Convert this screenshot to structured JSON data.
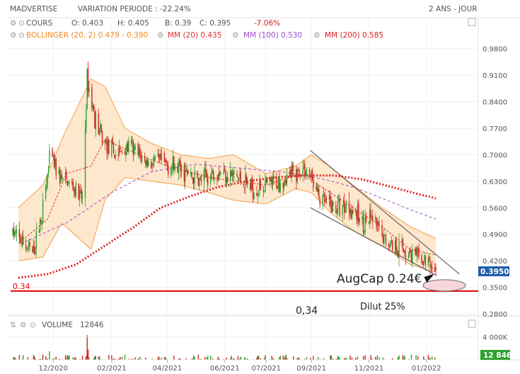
{
  "header": {
    "symbol": "MADVERTISE",
    "variation": "VARIATION PERIODE : -22.24%",
    "period": "2 ANS - JOUR"
  },
  "legend": {
    "cours_label": "COURS",
    "open": "O: 0.403",
    "high": "H: 0.405",
    "low": "B: 0.39",
    "close": "C: 0.395",
    "change": "-7.06%",
    "bollinger": "BOLLINGER (20, 2) 0.479 - 0.390",
    "mm20": "MM (20) 0.435",
    "mm100": "MM (100) 0.530",
    "mm200": "MM (200) 0.585"
  },
  "volume_legend": {
    "label": "VOLUME",
    "value": "12846"
  },
  "annotations": {
    "augcap": "AugCap 0.24€",
    "level_left": "0.34",
    "level_mid": "0,34",
    "dilut": "Dilut 25%"
  },
  "price_badge": "0.3950",
  "volume_badge": "12 846",
  "colors": {
    "up": "#2ea12e",
    "down": "#d62020",
    "bollinger": "#f5a04a",
    "bollinger_fill": "#fde3c4",
    "mm20": "#e03030",
    "mm100": "#9b4fc9",
    "mm200": "#e02020",
    "support": "#e00000",
    "channel": "#555555",
    "badge": "#1f5fa8",
    "volume_badge": "#2ea12e"
  },
  "chart_data": {
    "type": "candlestick",
    "title": "MADVERTISE",
    "y_ticks": [
      "0.9800",
      "0.9100",
      "0.8400",
      "0.7700",
      "0.7000",
      "0.6300",
      "0.5600",
      "0.4900",
      "0.4200",
      "0.3500",
      "0.2800"
    ],
    "ylim": [
      0.28,
      1.0
    ],
    "x_ticks": [
      "12/2020",
      "02/2021",
      "04/2021",
      "06/2021",
      "07/2021",
      "09/2021",
      "11/2021",
      "01/2022"
    ],
    "x_tick_dates": [
      "2020-12-01",
      "2021-02-01",
      "2021-04-01",
      "2021-06-01",
      "2021-07-15",
      "2021-09-01",
      "2021-11-01",
      "2022-01-01"
    ],
    "date_range": [
      "2020-10-19",
      "2022-01-11"
    ],
    "volume_ticks": [
      "4 000K",
      "0"
    ],
    "volume_max": 5200,
    "last": {
      "open": 0.403,
      "high": 0.405,
      "low": 0.39,
      "close": 0.395,
      "change_pct": -7.06
    },
    "close_anchors": [
      [
        "2020-10-19",
        0.495
      ],
      [
        "2020-11-01",
        0.46
      ],
      [
        "2020-11-10",
        0.44
      ],
      [
        "2020-11-20",
        0.56
      ],
      [
        "2020-11-28",
        0.7
      ],
      [
        "2020-12-08",
        0.64
      ],
      [
        "2020-12-20",
        0.62
      ],
      [
        "2021-01-01",
        0.58
      ],
      [
        "2021-01-06",
        0.9
      ],
      [
        "2021-01-14",
        0.8
      ],
      [
        "2021-01-22",
        0.74
      ],
      [
        "2021-02-05",
        0.7
      ],
      [
        "2021-02-20",
        0.72
      ],
      [
        "2021-03-10",
        0.68
      ],
      [
        "2021-03-25",
        0.68
      ],
      [
        "2021-04-15",
        0.66
      ],
      [
        "2021-05-05",
        0.63
      ],
      [
        "2021-05-25",
        0.66
      ],
      [
        "2021-06-15",
        0.64
      ],
      [
        "2021-07-01",
        0.61
      ],
      [
        "2021-07-20",
        0.62
      ],
      [
        "2021-08-10",
        0.645
      ],
      [
        "2021-08-25",
        0.665
      ],
      [
        "2021-09-01",
        0.64
      ],
      [
        "2021-09-10",
        0.58
      ],
      [
        "2021-09-25",
        0.56
      ],
      [
        "2021-10-10",
        0.57
      ],
      [
        "2021-10-25",
        0.52
      ],
      [
        "2021-11-05",
        0.53
      ],
      [
        "2021-11-15",
        0.48
      ],
      [
        "2021-11-30",
        0.46
      ],
      [
        "2021-12-15",
        0.44
      ],
      [
        "2021-12-28",
        0.42
      ],
      [
        "2022-01-05",
        0.41
      ],
      [
        "2022-01-11",
        0.395
      ]
    ],
    "mm20_anchors": [
      [
        "2020-11-01",
        0.48
      ],
      [
        "2020-11-25",
        0.53
      ],
      [
        "2020-12-15",
        0.65
      ],
      [
        "2021-01-10",
        0.67
      ],
      [
        "2021-01-25",
        0.74
      ],
      [
        "2021-02-20",
        0.71
      ],
      [
        "2021-04-01",
        0.67
      ],
      [
        "2021-05-15",
        0.64
      ],
      [
        "2021-07-15",
        0.62
      ],
      [
        "2021-08-20",
        0.65
      ],
      [
        "2021-09-15",
        0.61
      ],
      [
        "2021-10-15",
        0.56
      ],
      [
        "2021-11-15",
        0.51
      ],
      [
        "2021-12-15",
        0.45
      ],
      [
        "2022-01-11",
        0.435
      ]
    ],
    "bollinger_upper": [
      [
        "2020-10-25",
        0.56
      ],
      [
        "2020-11-20",
        0.62
      ],
      [
        "2020-12-10",
        0.74
      ],
      [
        "2021-01-10",
        0.9
      ],
      [
        "2021-01-25",
        0.88
      ],
      [
        "2021-02-15",
        0.77
      ],
      [
        "2021-03-15",
        0.73
      ],
      [
        "2021-04-15",
        0.7
      ],
      [
        "2021-05-15",
        0.69
      ],
      [
        "2021-06-10",
        0.7
      ],
      [
        "2021-07-15",
        0.65
      ],
      [
        "2021-08-15",
        0.67
      ],
      [
        "2021-09-01",
        0.7
      ],
      [
        "2021-09-20",
        0.67
      ],
      [
        "2021-10-15",
        0.62
      ],
      [
        "2021-11-15",
        0.56
      ],
      [
        "2021-12-15",
        0.51
      ],
      [
        "2022-01-11",
        0.479
      ]
    ],
    "bollinger_lower": [
      [
        "2020-10-25",
        0.42
      ],
      [
        "2020-11-20",
        0.43
      ],
      [
        "2020-12-10",
        0.52
      ],
      [
        "2021-01-10",
        0.45
      ],
      [
        "2021-01-25",
        0.58
      ],
      [
        "2021-02-15",
        0.64
      ],
      [
        "2021-03-15",
        0.63
      ],
      [
        "2021-04-15",
        0.62
      ],
      [
        "2021-05-15",
        0.6
      ],
      [
        "2021-06-10",
        0.58
      ],
      [
        "2021-07-15",
        0.57
      ],
      [
        "2021-08-15",
        0.61
      ],
      [
        "2021-09-01",
        0.6
      ],
      [
        "2021-09-20",
        0.55
      ],
      [
        "2021-10-15",
        0.5
      ],
      [
        "2021-11-15",
        0.46
      ],
      [
        "2021-12-15",
        0.41
      ],
      [
        "2022-01-11",
        0.39
      ]
    ],
    "mm100_anchors": [
      [
        "2020-11-01",
        0.47
      ],
      [
        "2020-12-15",
        0.52
      ],
      [
        "2021-02-01",
        0.6
      ],
      [
        "2021-03-15",
        0.655
      ],
      [
        "2021-05-01",
        0.675
      ],
      [
        "2021-06-15",
        0.665
      ],
      [
        "2021-08-01",
        0.655
      ],
      [
        "2021-09-15",
        0.635
      ],
      [
        "2021-10-15",
        0.615
      ],
      [
        "2021-11-15",
        0.585
      ],
      [
        "2021-12-15",
        0.555
      ],
      [
        "2022-01-11",
        0.53
      ]
    ],
    "mm200_anchors": [
      [
        "2020-10-25",
        0.375
      ],
      [
        "2020-11-25",
        0.385
      ],
      [
        "2020-12-25",
        0.41
      ],
      [
        "2021-01-25",
        0.46
      ],
      [
        "2021-02-25",
        0.51
      ],
      [
        "2021-03-25",
        0.56
      ],
      [
        "2021-04-25",
        0.59
      ],
      [
        "2021-05-25",
        0.615
      ],
      [
        "2021-06-25",
        0.63
      ],
      [
        "2021-07-25",
        0.64
      ],
      [
        "2021-08-25",
        0.645
      ],
      [
        "2021-09-25",
        0.645
      ],
      [
        "2021-10-25",
        0.635
      ],
      [
        "2021-11-25",
        0.615
      ],
      [
        "2021-12-25",
        0.595
      ],
      [
        "2022-01-11",
        0.585
      ]
    ],
    "channel_upper": [
      [
        "2021-08-31",
        0.711
      ],
      [
        "2022-02-05",
        0.385
      ]
    ],
    "channel_lower": [
      [
        "2021-08-31",
        0.56
      ],
      [
        "2022-01-12",
        0.381
      ]
    ],
    "support_level": 0.34,
    "annotation_ellipse_center": [
      "2022-01-20",
      0.355
    ]
  }
}
